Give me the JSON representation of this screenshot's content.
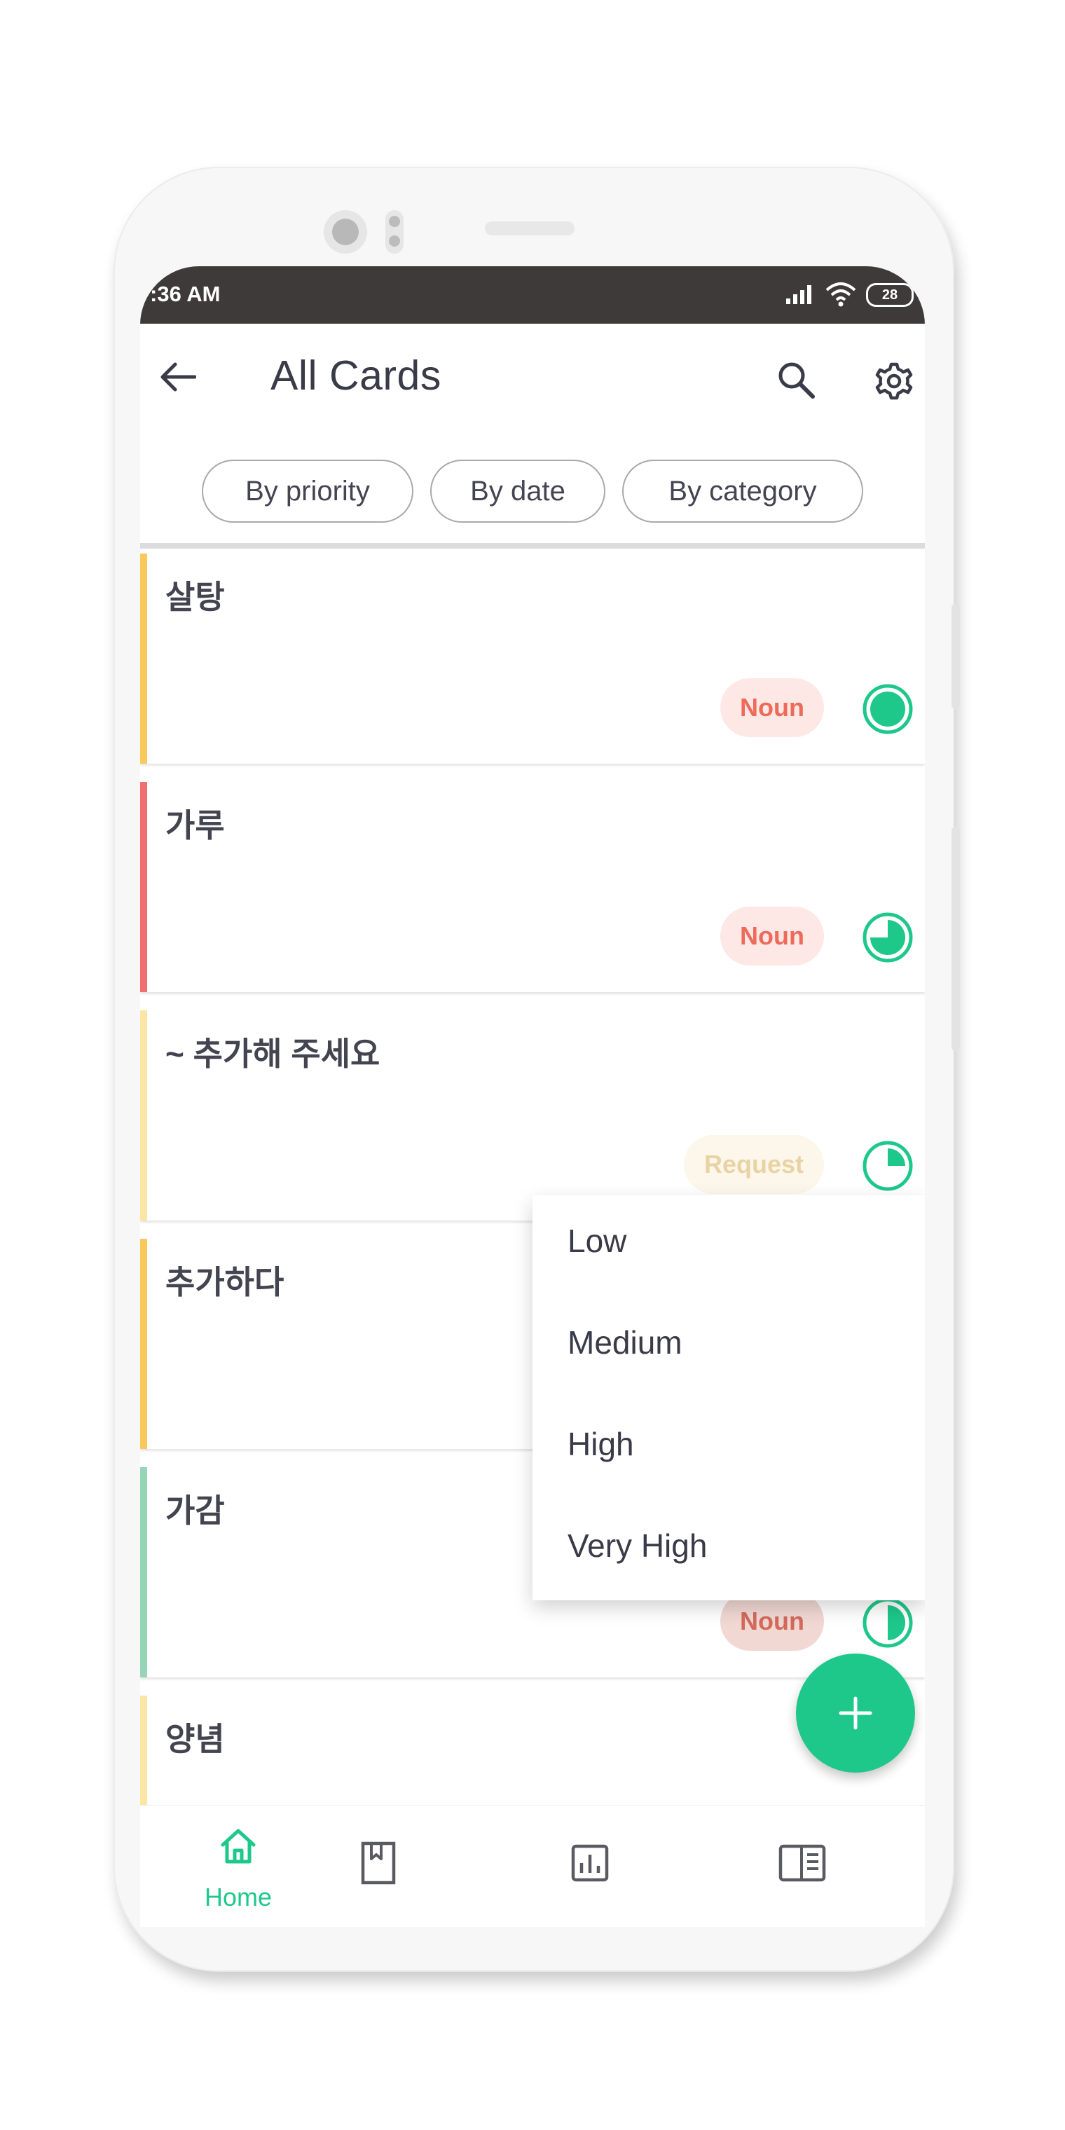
{
  "status_bar": {
    "time": ":36 AM",
    "battery": "28"
  },
  "app_bar": {
    "title": "All Cards"
  },
  "filters": [
    "By priority",
    "By date",
    "By category"
  ],
  "cards": [
    {
      "word": "살탕",
      "tag": "Noun",
      "bar_color": "#f9c95b",
      "tag_color": "#ee6a5a",
      "tag_bg": "#fde8e6",
      "priority_fraction": 1.0
    },
    {
      "word": "가루",
      "tag": "Noun",
      "bar_color": "#f07070",
      "tag_color": "#ee6a5a",
      "tag_bg": "#fde8e6",
      "priority_fraction": 0.75
    },
    {
      "word": "~ 추가해 주세요",
      "tag": "Request",
      "bar_color": "#fbe6a6",
      "tag_color": "#e8d3a4",
      "tag_bg": "#fcf7ea",
      "priority_fraction": 0.25
    },
    {
      "word": "추가하다",
      "tag": "",
      "bar_color": "#f9c95b",
      "tag_color": "#ee6a5a",
      "tag_bg": "#fde8e6",
      "priority_fraction": 0
    },
    {
      "word": "가감",
      "tag": "Noun",
      "bar_color": "#96d6b6",
      "tag_color": "#d46a5c",
      "tag_bg": "#f1d8d3",
      "priority_fraction": 0.5
    },
    {
      "word": "양념",
      "tag": "",
      "bar_color": "#fbe6a6",
      "tag_color": "#ee6a5a",
      "tag_bg": "#fde8e6",
      "priority_fraction": 0
    }
  ],
  "priority_menu": [
    "Low",
    "Medium",
    "High",
    "Very High"
  ],
  "bottom_nav": {
    "home_label": "Home"
  },
  "colors": {
    "accent": "#1ec88a",
    "statusbar": "#3d3a39",
    "text": "#3a3a48"
  }
}
